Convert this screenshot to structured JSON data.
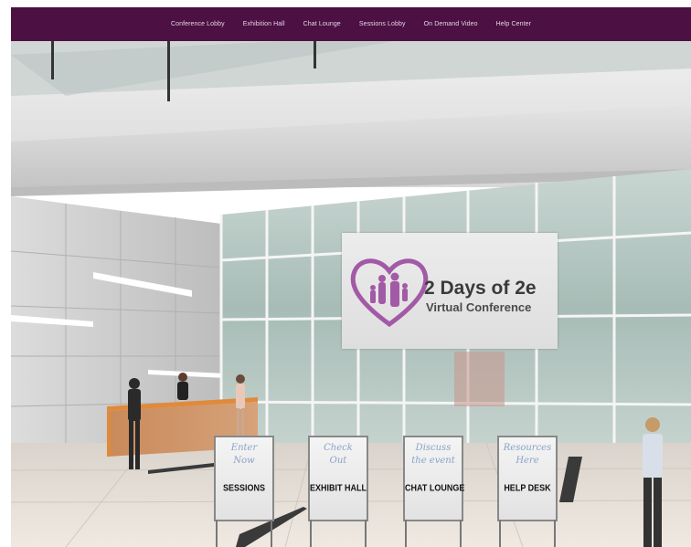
{
  "navbar": {
    "background": "#4c1042",
    "items": [
      {
        "label": "Conference Lobby"
      },
      {
        "label": "Exhibition Hall"
      },
      {
        "label": "Chat Lounge"
      },
      {
        "label": "Sessions Lobby"
      },
      {
        "label": "On Demand Video"
      },
      {
        "label": "Help Center"
      }
    ]
  },
  "banner": {
    "title": "2 Days of 2e",
    "subtitle": "Virtual Conference",
    "logo_color": "#a35aa6"
  },
  "signs": [
    {
      "line1": "Enter",
      "line2": "Now",
      "label": "SESSIONS"
    },
    {
      "line1": "Check",
      "line2": "Out",
      "label": "EXHIBIT HALL"
    },
    {
      "line1": "Discuss",
      "line2": "the event",
      "label": "CHAT LOUNGE"
    },
    {
      "line1": "Resources",
      "line2": "Here",
      "label": "HELP DESK"
    }
  ]
}
